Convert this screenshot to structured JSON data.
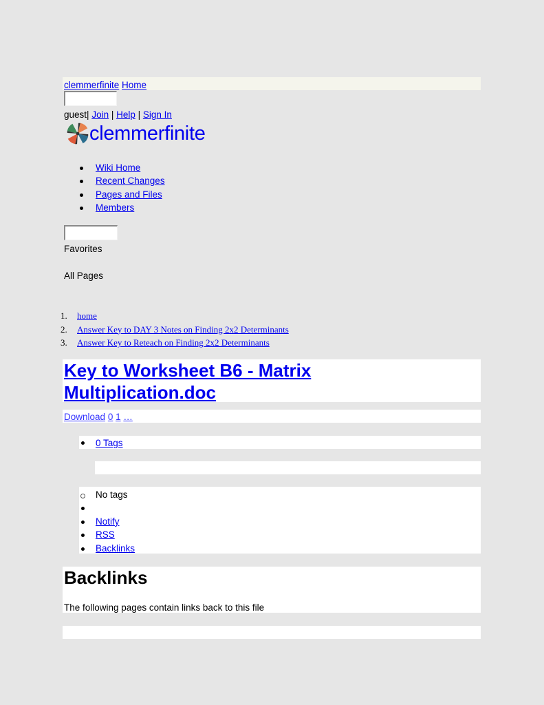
{
  "header": {
    "site_link": "clemmerfinite",
    "home_link": "Home",
    "search_value": "",
    "user": {
      "name": "guest",
      "separator": "|",
      "join": "Join",
      "help": "Help",
      "sign_in": "Sign In"
    },
    "logo_text": "clemmerfinite",
    "logo_colors": [
      "#e8834e",
      "#2b6e8f",
      "#e05a3a",
      "#3d8a5a",
      "#333333"
    ]
  },
  "nav": {
    "items": [
      {
        "label": "Wiki Home"
      },
      {
        "label": "Recent Changes"
      },
      {
        "label": "Pages and Files"
      },
      {
        "label": "Members"
      }
    ]
  },
  "sidebar": {
    "search_value": "",
    "favorites_label": "Favorites",
    "all_pages_label": "All Pages"
  },
  "breadcrumbs": [
    {
      "num": "1.",
      "label": "home"
    },
    {
      "num": "2.",
      "label": "Answer Key to DAY 3 Notes on Finding 2x2 Determinants"
    },
    {
      "num": "3.",
      "label": "Answer Key to Reteach on Finding 2x2 Determinants"
    }
  ],
  "file": {
    "title_line1": "Key to Worksheet B6 - Matrix",
    "title_line2": "Multiplication.doc",
    "download_label": "Download",
    "link_0": "0",
    "link_1": "1",
    "link_more": "…"
  },
  "tags": {
    "tags_link": "0 Tags",
    "no_tags": "No tags"
  },
  "actions": {
    "notify": "Notify",
    "rss": "RSS",
    "backlinks": "Backlinks"
  },
  "backlinks_section": {
    "heading": "Backlinks",
    "description": "The following pages contain links back to this file"
  },
  "colors": {
    "background": "#e6e6e6",
    "topbar": "#f5f5ec",
    "link": "#0000ee",
    "panel": "#ffffff"
  }
}
